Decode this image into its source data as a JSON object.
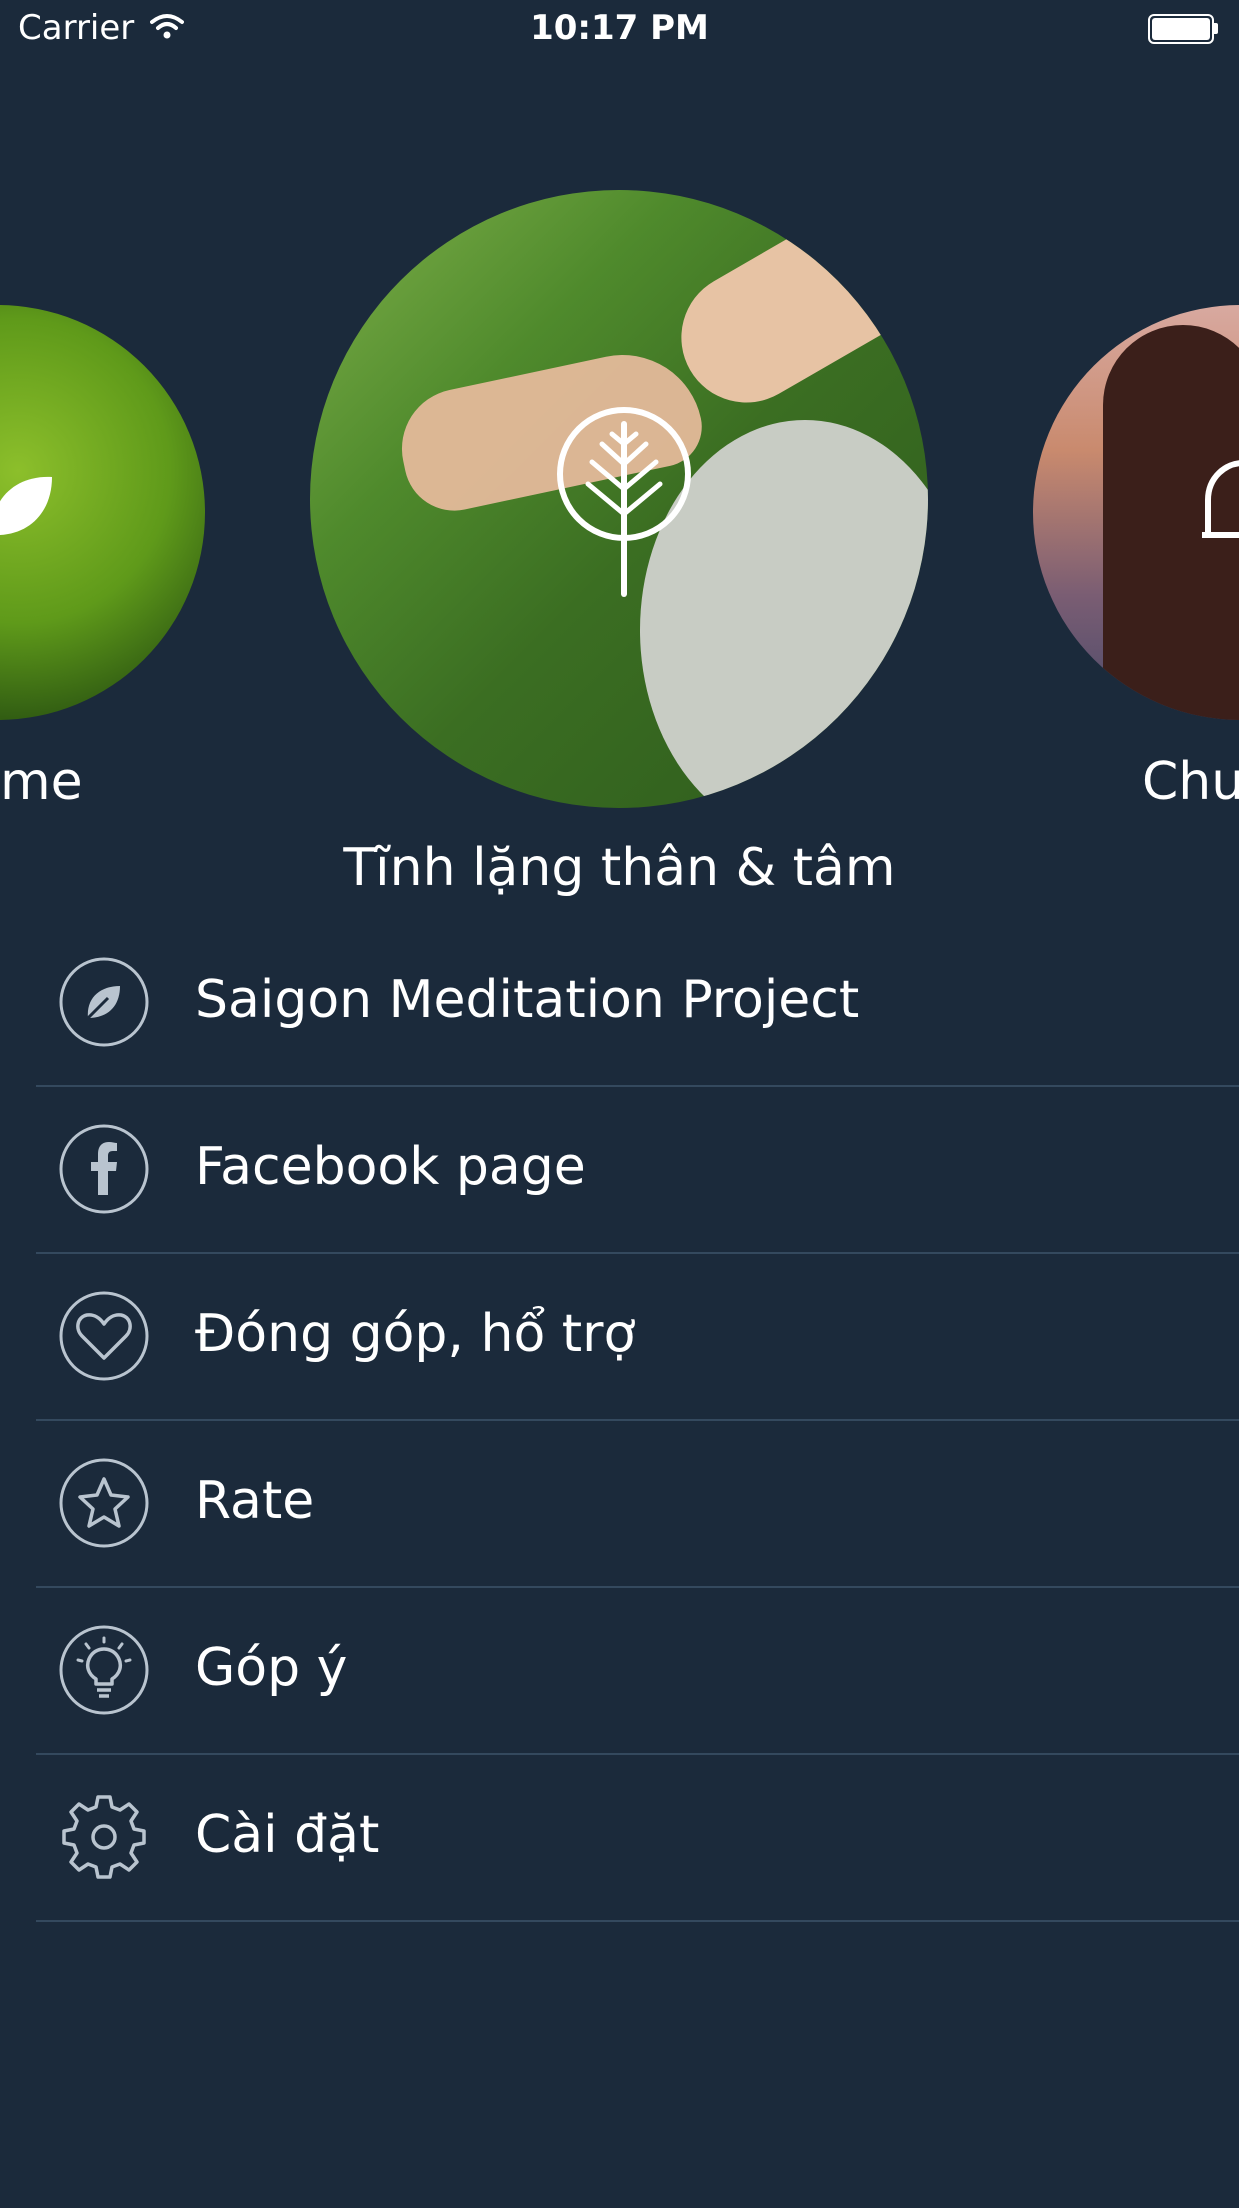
{
  "status_bar": {
    "carrier": "Carrier",
    "time": "10:17 PM"
  },
  "carousel": {
    "left_label": "me",
    "center_label": "Tĩnh lặng thân & tâm",
    "right_label": "Chu",
    "left_icon": "leaf-icon",
    "center_icon": "tree-icon",
    "right_icon": "bell-icon"
  },
  "menu": {
    "items": [
      {
        "label": "Saigon Meditation Project",
        "icon": "leaf-icon"
      },
      {
        "label": "Facebook page",
        "icon": "facebook-icon"
      },
      {
        "label": "Đóng góp, hổ trợ",
        "icon": "heart-icon"
      },
      {
        "label": "Rate",
        "icon": "star-icon"
      },
      {
        "label": "Góp ý",
        "icon": "lightbulb-icon"
      },
      {
        "label": "Cài đặt",
        "icon": "gear-icon"
      }
    ]
  },
  "colors": {
    "background": "#1b2a3b",
    "divider": "#34495e",
    "icon_stroke": "#b9c4cf",
    "text": "#ffffff"
  }
}
